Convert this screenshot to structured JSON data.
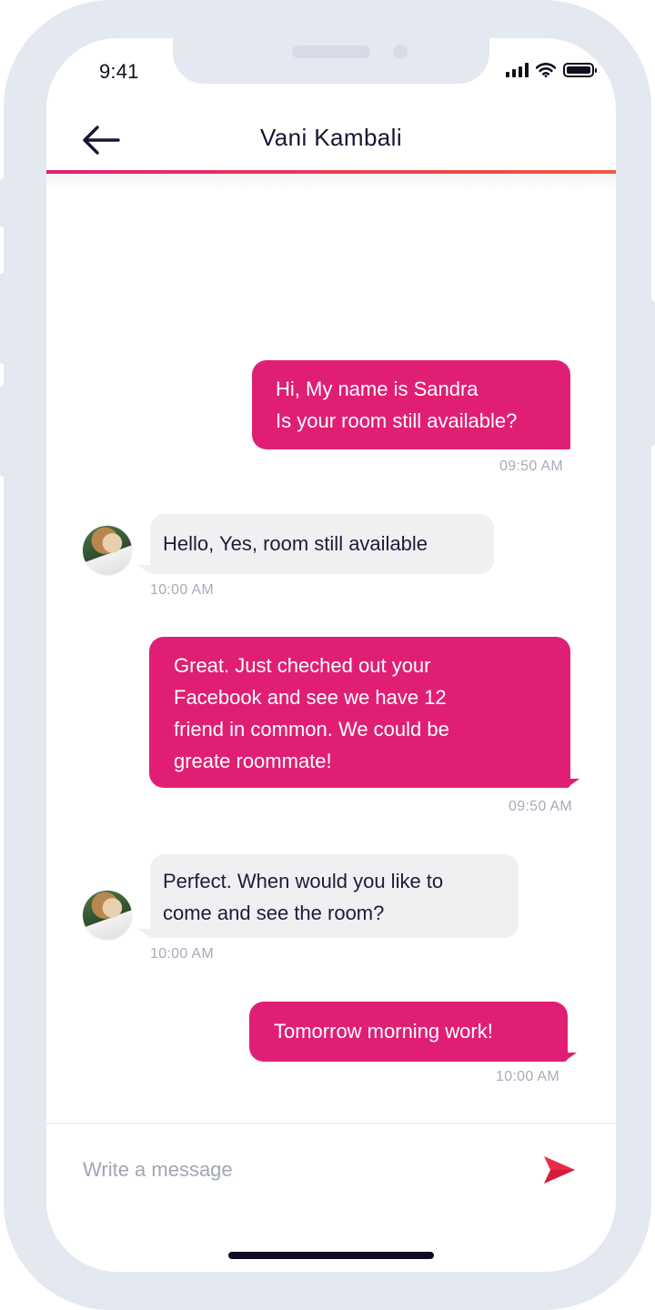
{
  "status_bar": {
    "time": "9:41"
  },
  "header": {
    "title": "Vani Kambali"
  },
  "messages": [
    {
      "direction": "outgoing",
      "lines": [
        "Hi, My name is Sandra",
        "Is your room still available?"
      ],
      "time": "09:50 AM"
    },
    {
      "direction": "incoming",
      "lines": [
        "Hello, Yes, room still available"
      ],
      "time": "10:00 AM"
    },
    {
      "direction": "outgoing",
      "lines": [
        "Great. Just cheched out your",
        "Facebook and see we have 12",
        "friend in common. We could be",
        "greate roommate!"
      ],
      "time": "09:50 AM"
    },
    {
      "direction": "incoming",
      "lines": [
        "Perfect. When would you like to",
        "come and see the room?"
      ],
      "time": "10:00 AM"
    },
    {
      "direction": "outgoing",
      "lines": [
        "Tomorrow morning work!"
      ],
      "time": "10:00 AM"
    }
  ],
  "composer": {
    "placeholder": "Write a message"
  },
  "colors": {
    "accent": "#e01f74",
    "accent_end": "#f05a3c",
    "incoming_bubble": "#f0f0f2",
    "text_dark": "#151533"
  },
  "icons": [
    "back-arrow-icon",
    "send-icon",
    "signal-icon",
    "wifi-icon",
    "battery-icon"
  ]
}
